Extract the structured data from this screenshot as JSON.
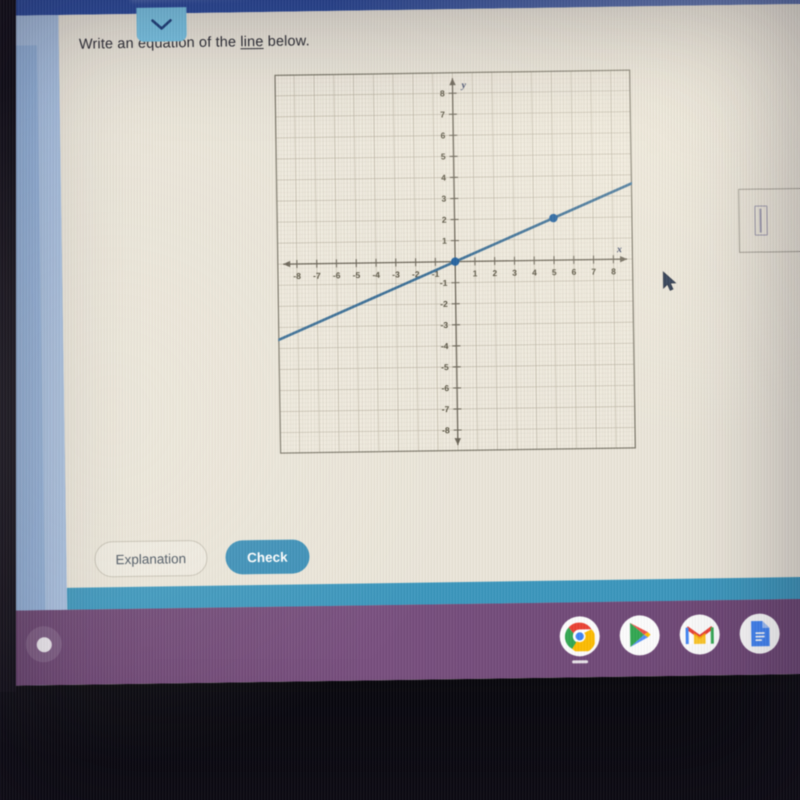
{
  "app": {
    "header_color": "#2b4a9b",
    "page_background": "#eae5d9",
    "accent_color": "#3d90b8",
    "shelf_color": "#6e4a75"
  },
  "question": {
    "prompt_prefix": "Write an equation of the ",
    "prompt_link": "line",
    "prompt_suffix": " below.",
    "dropdown_tab_icon": "chevron-down-icon"
  },
  "answer": {
    "value": "",
    "placeholder": ""
  },
  "buttons": {
    "explanation_label": "Explanation",
    "check_label": "Check"
  },
  "shelf": {
    "launcher_label": "launcher",
    "apps": [
      {
        "name": "chrome-icon",
        "label": "Chrome",
        "running": true
      },
      {
        "name": "play-store-icon",
        "label": "Play Store",
        "running": false
      },
      {
        "name": "gmail-icon",
        "label": "Gmail",
        "running": false
      },
      {
        "name": "google-docs-icon",
        "label": "Docs",
        "running": false
      }
    ]
  },
  "chart_data": {
    "type": "line",
    "title": "",
    "xlabel": "x",
    "ylabel": "y",
    "xlim": [
      -9,
      9
    ],
    "ylim": [
      -9,
      9
    ],
    "xticks": [
      -8,
      -7,
      -6,
      -5,
      -4,
      -3,
      -2,
      -1,
      1,
      2,
      3,
      4,
      5,
      6,
      7,
      8
    ],
    "yticks": [
      8,
      7,
      6,
      5,
      4,
      3,
      2,
      1,
      -1,
      -2,
      -3,
      -4,
      -5,
      -6,
      -7,
      -8
    ],
    "grid": true,
    "minor_grid": true,
    "line_color": "#3a6e96",
    "point_color": "#1f5f9e",
    "slope": 0.4,
    "intercept": 0,
    "equation": "y = (2/5)x",
    "marked_points": [
      {
        "x": 0,
        "y": 0
      },
      {
        "x": 5,
        "y": 2
      }
    ],
    "series": [
      {
        "name": "line",
        "x": [
          -9,
          9
        ],
        "y": [
          -3.6,
          3.6
        ]
      }
    ]
  }
}
